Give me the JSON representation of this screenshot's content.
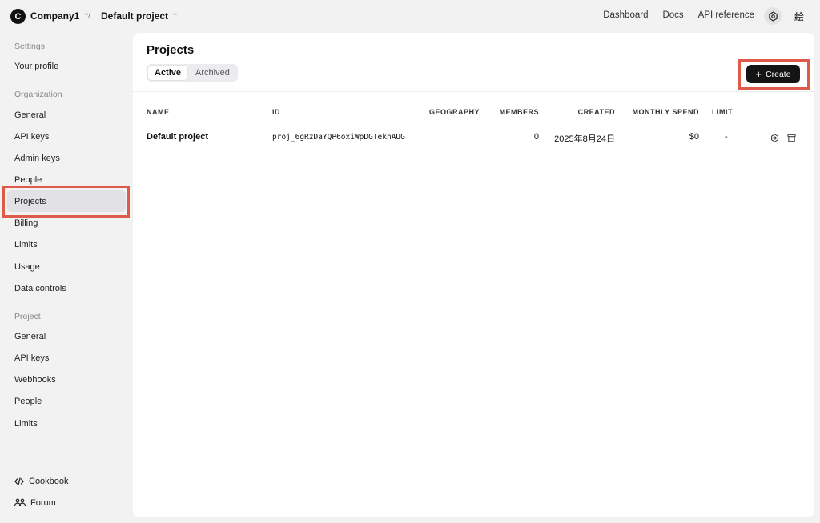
{
  "topbar": {
    "org_initial": "C",
    "org_name": "Company1",
    "separator": "/",
    "project_name": "Default project",
    "links": [
      "Dashboard",
      "Docs",
      "API reference"
    ],
    "avatar_glyph": "絵"
  },
  "sidebar": {
    "settings_label": "Settings",
    "your_profile": "Your profile",
    "organization_label": "Organization",
    "org_items": [
      "General",
      "API keys",
      "Admin keys",
      "People",
      "Projects",
      "Billing",
      "Limits",
      "Usage",
      "Data controls"
    ],
    "project_label": "Project",
    "project_items": [
      "General",
      "API keys",
      "Webhooks",
      "People",
      "Limits"
    ],
    "footer": [
      {
        "label": "Cookbook",
        "icon": "code-icon"
      },
      {
        "label": "Forum",
        "icon": "people-icon"
      }
    ],
    "active_item": "Projects"
  },
  "main": {
    "title": "Projects",
    "tabs": [
      {
        "label": "Active",
        "selected": true
      },
      {
        "label": "Archived",
        "selected": false
      }
    ],
    "create_label": "Create",
    "columns": [
      "NAME",
      "ID",
      "GEOGRAPHY",
      "MEMBERS",
      "CREATED",
      "MONTHLY SPEND",
      "LIMIT"
    ],
    "rows": [
      {
        "name": "Default project",
        "id": "proj_6gRzDaYQP6oxiWpDGTeknAUG",
        "geography": "",
        "members": "0",
        "created": "2025年8月24日",
        "monthly_spend": "$0",
        "limit": "-"
      }
    ]
  },
  "colors": {
    "highlight": "#e05a4a",
    "create_button": "#141414",
    "background": "#f2f2f3"
  }
}
